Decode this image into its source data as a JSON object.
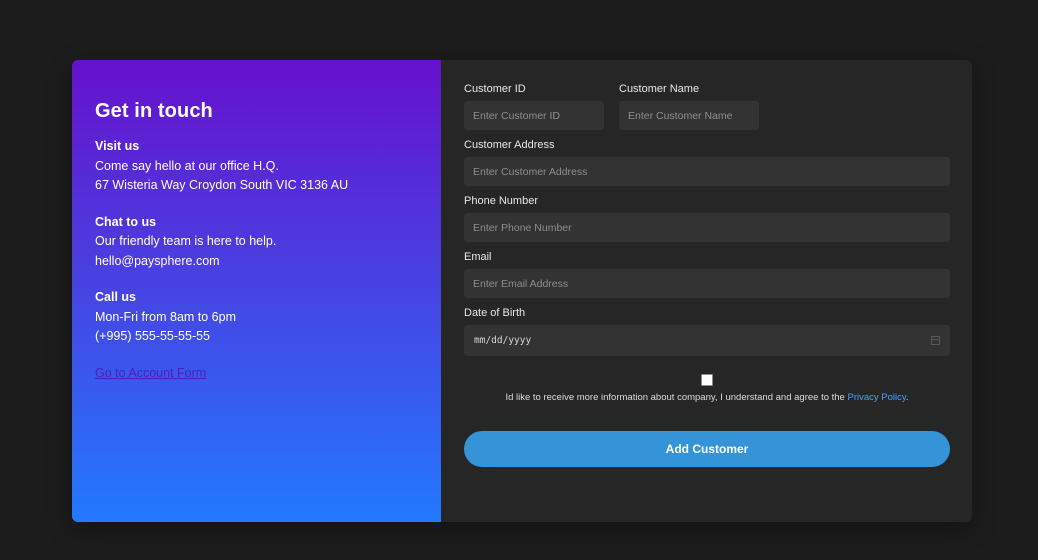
{
  "contact": {
    "title": "Get in touch",
    "visit": {
      "heading": "Visit us",
      "line1": "Come say hello at our office H.Q.",
      "line2": "67 Wisteria Way Croydon South VIC 3136 AU"
    },
    "chat": {
      "heading": "Chat to us",
      "line1": "Our friendly team is here to help.",
      "line2": "hello@paysphere.com"
    },
    "call": {
      "heading": "Call us",
      "line1": "Mon-Fri from 8am to 6pm",
      "line2": "(+995) 555-55-55-55"
    },
    "account_link": "Go to Account Form"
  },
  "form": {
    "customer_id": {
      "label": "Customer ID",
      "placeholder": "Enter Customer ID"
    },
    "customer_name": {
      "label": "Customer Name",
      "placeholder": "Enter Customer Name"
    },
    "customer_address": {
      "label": "Customer Address",
      "placeholder": "Enter Customer Address"
    },
    "phone": {
      "label": "Phone Number",
      "placeholder": "Enter Phone Number"
    },
    "email": {
      "label": "Email",
      "placeholder": "Enter Email Address"
    },
    "dob": {
      "label": "Date of Birth",
      "value": "mm/dd/yyyy"
    },
    "consent": {
      "checked": false,
      "text": "Id like to receive more information about company, I understand and agree to the ",
      "link": "Privacy Policy",
      "suffix": "."
    },
    "submit_label": "Add Customer"
  },
  "colors": {
    "gradient_top": "#6611cc",
    "gradient_bottom": "#2379ff",
    "button": "#3594d8",
    "link": "#4aa0ff",
    "panel": "#262626",
    "background": "#1c1c1c"
  }
}
